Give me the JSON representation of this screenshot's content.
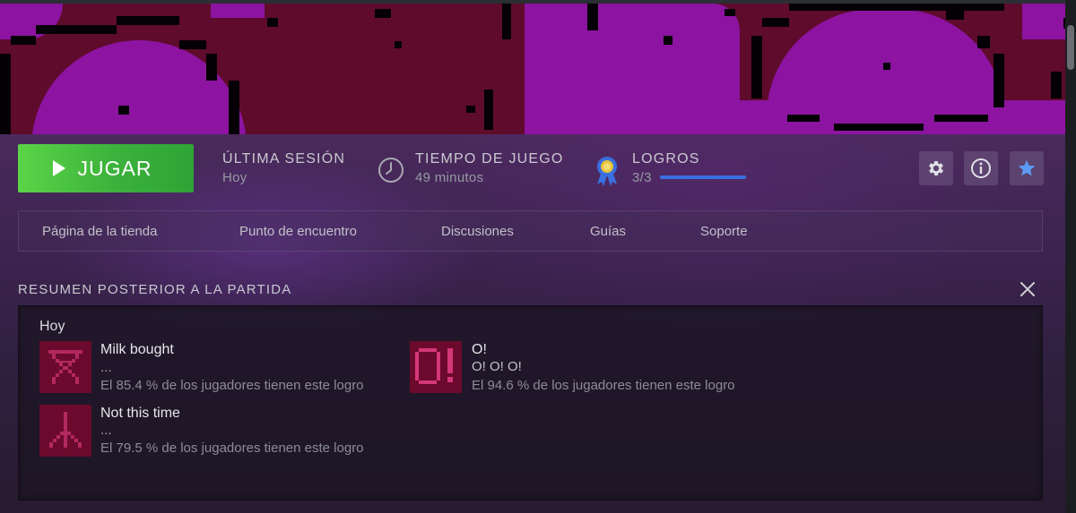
{
  "actions": {
    "play_label": "JUGAR",
    "last_session": {
      "label": "ÚLTIMA SESIÓN",
      "value": "Hoy"
    },
    "playtime": {
      "label": "TIEMPO DE JUEGO",
      "value": "49 minutos"
    },
    "achievements": {
      "label": "LOGROS",
      "value": "3/3",
      "progress": 1.0
    },
    "icons": [
      "gear-icon",
      "info-icon",
      "star-icon"
    ]
  },
  "nav": {
    "items": [
      "Página de la tienda",
      "Punto de encuentro",
      "Discusiones",
      "Guías",
      "Soporte"
    ]
  },
  "summary": {
    "title": "RESUMEN POSTERIOR A LA PARTIDA",
    "date": "Hoy",
    "achievements": [
      {
        "name": "Milk bought",
        "description": "...",
        "percent": "El 85.4 % de los jugadores tienen este logro",
        "icon": "hourglass-icon"
      },
      {
        "name": "O!",
        "description": "O! O! O!",
        "percent": "El 94.6 % de los jugadores tienen este logro",
        "icon": "o-exclaim-icon"
      },
      {
        "name": "Not this time",
        "description": "...",
        "percent": "El 79.5 % de los jugadores tienen este logro",
        "icon": "fork-icon"
      }
    ]
  },
  "colors": {
    "play_button": "#4cc33f",
    "accent_blue": "#3a6fe0",
    "hero_purple": "#8c14a1",
    "hero_red": "#5e0b2c"
  }
}
